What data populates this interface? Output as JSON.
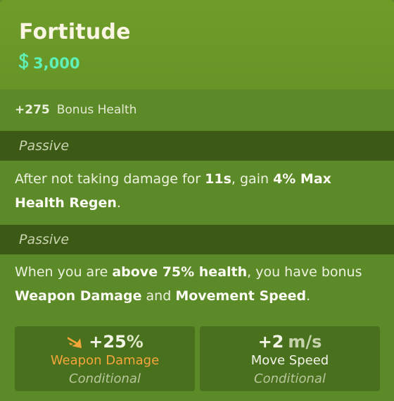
{
  "item": {
    "title": "Fortitude",
    "cost": "3,000",
    "cost_icon": "souls-icon",
    "accent_color": "#5ef0b6"
  },
  "bonus": {
    "value": "+275",
    "label": "Bonus Health"
  },
  "passives": [
    {
      "label": "Passive",
      "text_parts": {
        "p1": "After not taking damage for ",
        "b1": "11s",
        "p2": ", gain ",
        "b2": "4% Max Health Regen",
        "p3": "."
      }
    },
    {
      "label": "Passive",
      "text_parts": {
        "p1": "When you are ",
        "b1": "above 75% health",
        "p2": ", you have bonus ",
        "b2": "Weapon Damage",
        "p3": " and ",
        "b3": "Movement Speed",
        "p4": "."
      }
    }
  ],
  "stats": [
    {
      "icon": "weapon-damage-icon",
      "value": "+25",
      "unit": "%",
      "name": "Weapon Damage",
      "condition": "Conditional",
      "name_color": "#f5a63a"
    },
    {
      "value": "+2",
      "unit": "m/s",
      "name": "Move Speed",
      "condition": "Conditional",
      "name_color": "#f4f4ea"
    }
  ]
}
